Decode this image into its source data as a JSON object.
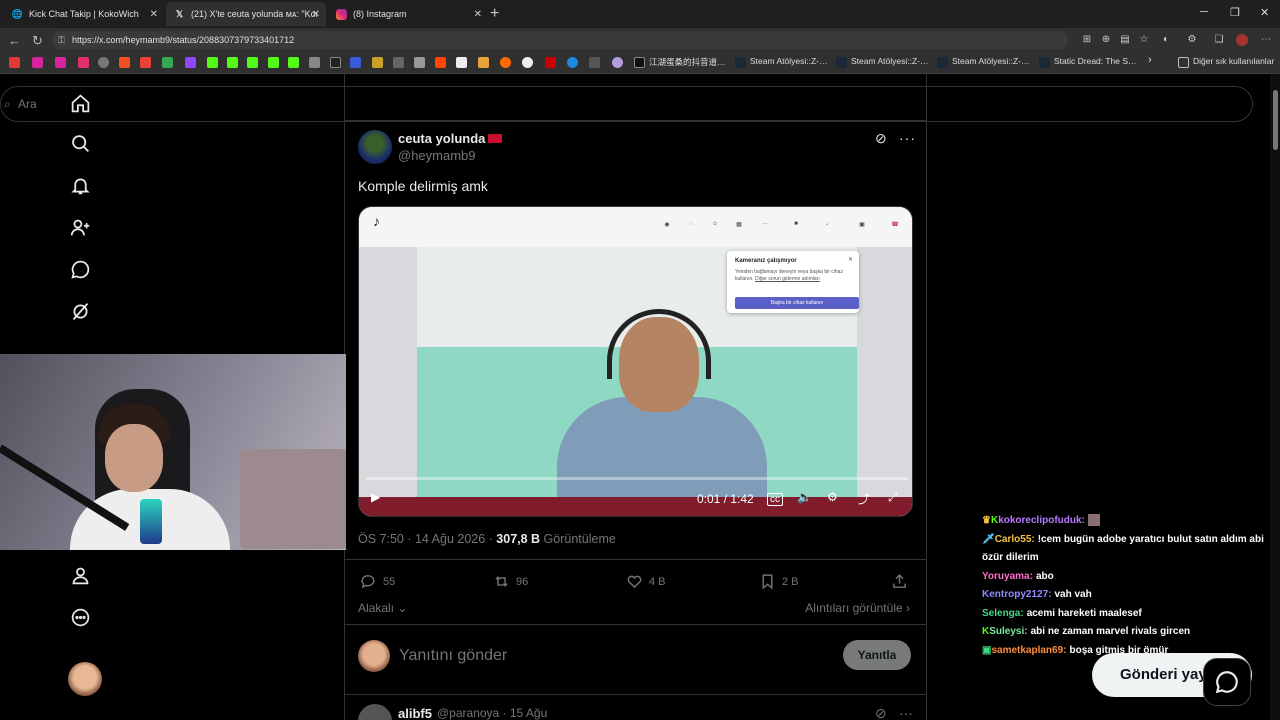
{
  "browser": {
    "tabs": [
      {
        "title": "Kick Chat Takip | KokoWich",
        "icon": "globe-icon"
      },
      {
        "title": "(21) X'te ceuta yolunda ᴍᴀ: \"Komp",
        "icon": "x-icon"
      },
      {
        "title": "(8) Instagram",
        "icon": "instagram-icon"
      }
    ],
    "url": "https://x.com/heymamb9/status/2088307379733401712",
    "bookmarks": {
      "chinese_site": "江湖蛋桑的抖音道…",
      "steam1": "Steam Atölyesi::Z-…",
      "steam2": "Steam Atölyesi::Z-…",
      "steam3": "Steam Atölyesi::Z-…",
      "static_dread": "Static Dread: The S…",
      "other_bookmarks": "Diğer sık kullanılanlar"
    }
  },
  "search": {
    "placeholder": "Ara"
  },
  "tweet": {
    "display_name": "ceuta yolunda",
    "handle": "@heymamb9",
    "text": "Komple delirmiş amk",
    "video": {
      "time": "0:01 / 1:42",
      "popup_title": "Kameranız çalışmıyor",
      "popup_body": "Yeniden bağlamayı deneyin veya başka bir cihaz kullanın.",
      "popup_link": "Diğer sorun giderme adımları",
      "popup_button": "Başka bir cihaz kullanın"
    },
    "time": "ÖS 7:50 · 14 Ağu 2026 · ",
    "views": "307,8 B",
    "views_label": " Görüntüleme",
    "replies": "55",
    "reposts": "96",
    "likes": "4 B",
    "bookmarks": "2 B",
    "related": "Alakalı",
    "quotes": "Alıntıları görüntüle"
  },
  "reply": {
    "placeholder": "Yanıtını gönder",
    "button": "Yanıtla"
  },
  "next_post": {
    "user": "alibf5",
    "meta": "@paranoya · 15 Ağu"
  },
  "chat": [
    {
      "user": "kokoreclipofuduk:",
      "msg": "",
      "color": "#b879ff"
    },
    {
      "user": "Carlo55:",
      "msg": "!cem bugün adobe yaratıcı bulut satın aldım abi özür dilerim",
      "color": "#f5c542"
    },
    {
      "user": "Yoruyama:",
      "msg": "abo",
      "color": "#ff6ec7"
    },
    {
      "user": "entropy2127:",
      "msg": "vah vah",
      "color": "#8f8cff"
    },
    {
      "user": "Selenga:",
      "msg": "acemi hareketi maalesef",
      "color": "#3ddc84"
    },
    {
      "user": "Suleysi:",
      "msg": "abi ne zaman marvel rivals gircen",
      "color": "#7ee8a2"
    },
    {
      "user": "sametkaplan69:",
      "msg": "boşa gitmiş bir ömür",
      "color": "#ff8c3a"
    }
  ],
  "cta": {
    "label": "Gönderi yayınla"
  },
  "colors": {
    "accent": "#1d9bf0",
    "background": "#000000",
    "text": "#e7e9ea",
    "muted": "#71767b"
  }
}
